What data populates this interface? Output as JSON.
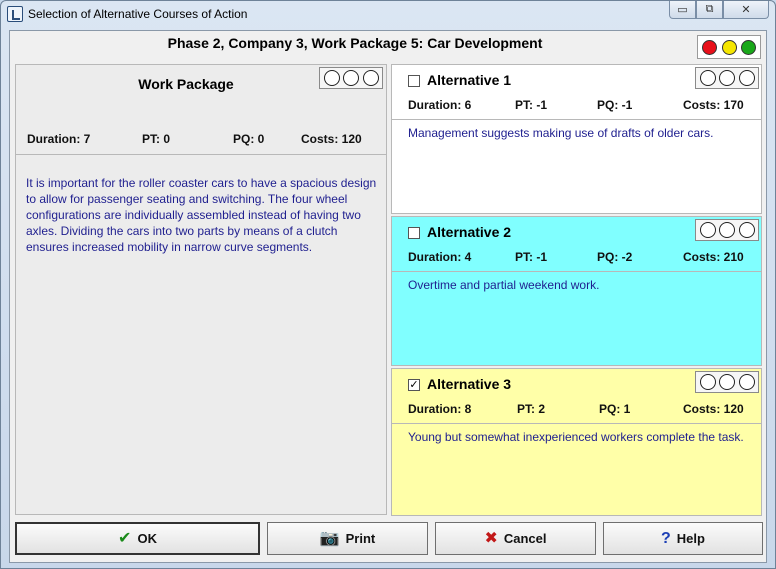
{
  "window": {
    "title": "Selection of Alternative Courses of Action",
    "minimize_glyph": "▭",
    "restore_glyph": "⧉",
    "close_glyph": "✕"
  },
  "header": {
    "phase_title": "Phase 2, Company 3, Work Package 5: Car Development",
    "traffic_light_colors": [
      "#e8101a",
      "#f5e600",
      "#1aa81a"
    ]
  },
  "work_package": {
    "title": "Work Package",
    "duration": "Duration: 7",
    "pt": "PT: 0",
    "pq": "PQ: 0",
    "costs": "Costs: 120",
    "description": "It is important for the roller coaster cars to have a spacious design to allow for passenger seating and switching. The four wheel configurations are individually assembled instead of having two axles. Dividing the cars into two parts by means of a clutch ensures increased mobility in narrow curve segments."
  },
  "alternatives": [
    {
      "title": "Alternative 1",
      "checked_glyph": "",
      "duration": "Duration: 6",
      "pt": "PT: -1",
      "pq": "PQ: -1",
      "costs": "Costs: 170",
      "description": "Management suggests making use of drafts of older cars.",
      "color": "#ffffff"
    },
    {
      "title": "Alternative 2",
      "checked_glyph": "",
      "duration": "Duration: 4",
      "pt": "PT: -1",
      "pq": "PQ: -2",
      "costs": "Costs: 210",
      "description": "Overtime and partial weekend work.",
      "color": "#80ffff"
    },
    {
      "title": "Alternative 3",
      "checked_glyph": "✓",
      "duration": "Duration: 8",
      "pt": "PT: 2",
      "pq": "PQ: 1",
      "costs": "Costs: 120",
      "description": "Young but somewhat inexperienced workers complete the task.",
      "color": "#ffffa8"
    }
  ],
  "buttons": {
    "ok": {
      "label": "OK",
      "icon": "✔"
    },
    "print": {
      "label": "Print",
      "icon": "📷"
    },
    "cancel": {
      "label": "Cancel",
      "icon": "✖"
    },
    "help": {
      "label": "Help",
      "icon": "?"
    }
  }
}
